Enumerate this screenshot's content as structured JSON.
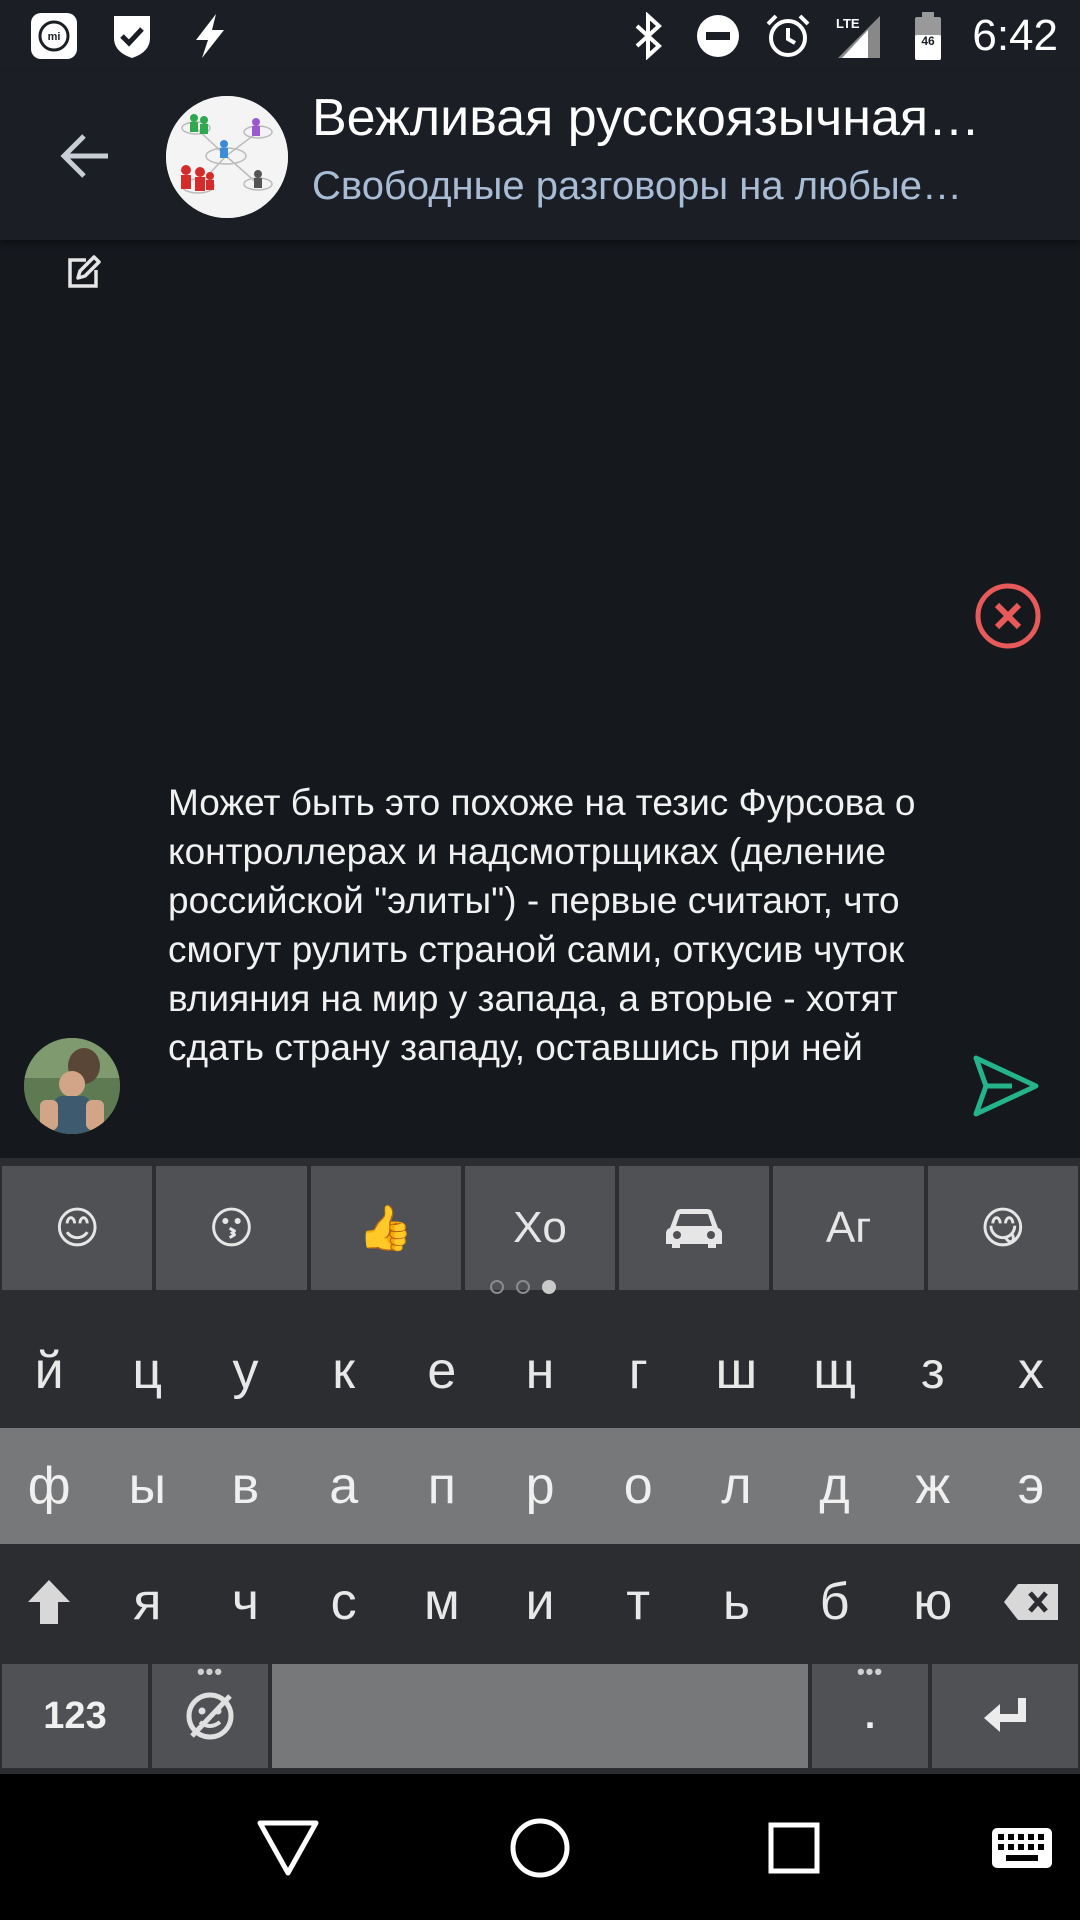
{
  "status_bar": {
    "time": "6:42",
    "icons": [
      "mi-icon",
      "shield-check-icon",
      "lightning-icon",
      "bluetooth-icon",
      "do-not-disturb-icon",
      "alarm-icon",
      "lte-signal-icon",
      "battery-icon"
    ],
    "network_label": "LTE",
    "battery_label": "46"
  },
  "header": {
    "title": "Вежливая русскоязычная…",
    "subtitle": "Свободные разговоры на любые…"
  },
  "composer": {
    "text": "Может быть это похоже на тезис Фурсова о контроллерах и надсмотрщиках (деление российской \"элиты\") - первые считают, что смогут рулить страной сами, откусив чуток влияния на мир у запада, а вторые - хотят сдать страну западу, оставшись при ней"
  },
  "colors": {
    "accent_send": "#25b38a",
    "cancel_red": "#e85a5a",
    "subtitle": "#a9bcd6"
  },
  "keyboard": {
    "emoji_row": [
      "😊",
      "😗",
      "👍",
      "Xo",
      "car-icon",
      "Аг",
      "😋"
    ],
    "row1": [
      "й",
      "ц",
      "у",
      "к",
      "е",
      "н",
      "г",
      "ш",
      "щ",
      "з",
      "х"
    ],
    "row2": [
      "ф",
      "ы",
      "в",
      "а",
      "п",
      "р",
      "о",
      "л",
      "д",
      "ж",
      "э"
    ],
    "row3": [
      "я",
      "ч",
      "с",
      "м",
      "и",
      "т",
      "ь",
      "б",
      "ю"
    ],
    "numbers_label": "123",
    "period_label": ".",
    "more_dots": "•••"
  }
}
